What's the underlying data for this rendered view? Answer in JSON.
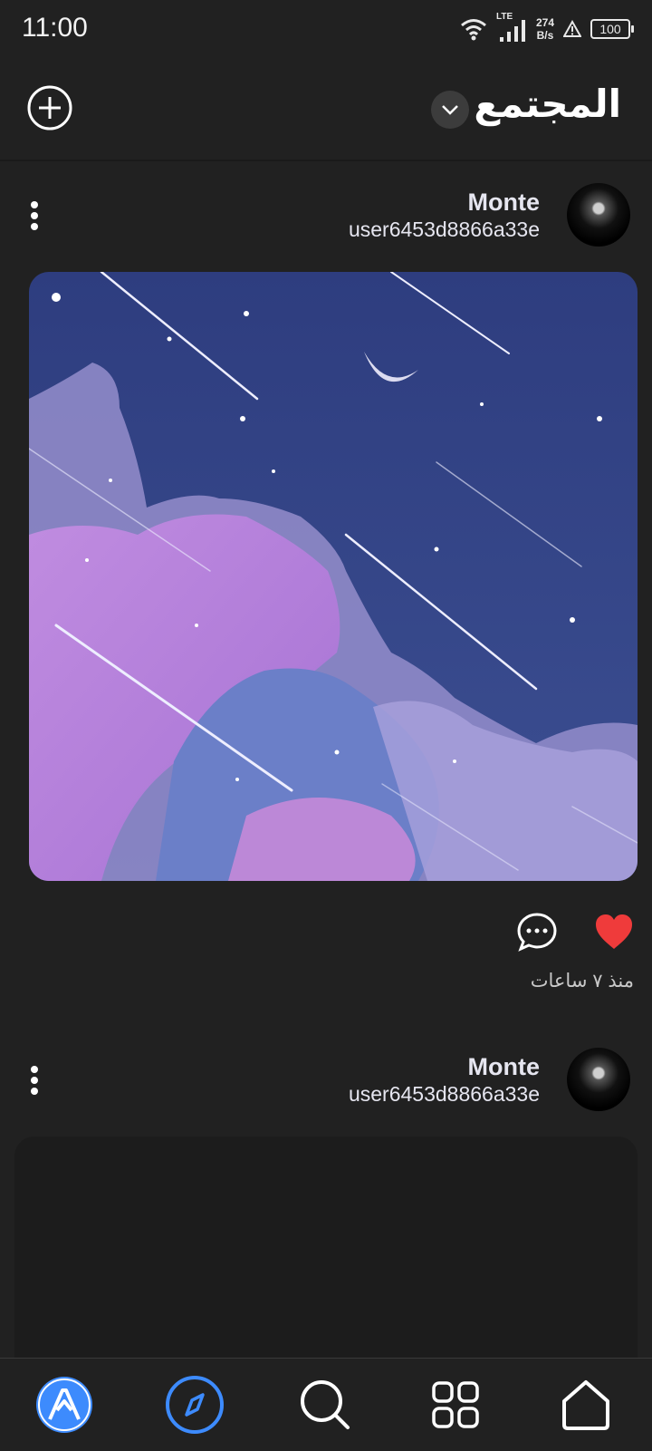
{
  "status": {
    "time": "11:00",
    "network": "LTE",
    "speed_value": "274",
    "speed_unit": "B/s",
    "battery": "100"
  },
  "header": {
    "title": "المجتمع"
  },
  "posts": [
    {
      "username": "Monte",
      "handle": "user6453d8866a33e",
      "time_ago": "منذ ٧ ساعات",
      "liked": true
    },
    {
      "username": "Monte",
      "handle": "user6453d8866a33e"
    }
  ],
  "colors": {
    "accent": "#3d8bfd",
    "like": "#ef3b3b",
    "background": "#212121"
  },
  "icons": [
    "plus-circle-icon",
    "chevron-down-icon",
    "kebab-menu-icon",
    "heart-icon",
    "comment-icon",
    "app-logo-icon",
    "compass-icon",
    "search-icon",
    "grid-icon",
    "home-icon"
  ]
}
